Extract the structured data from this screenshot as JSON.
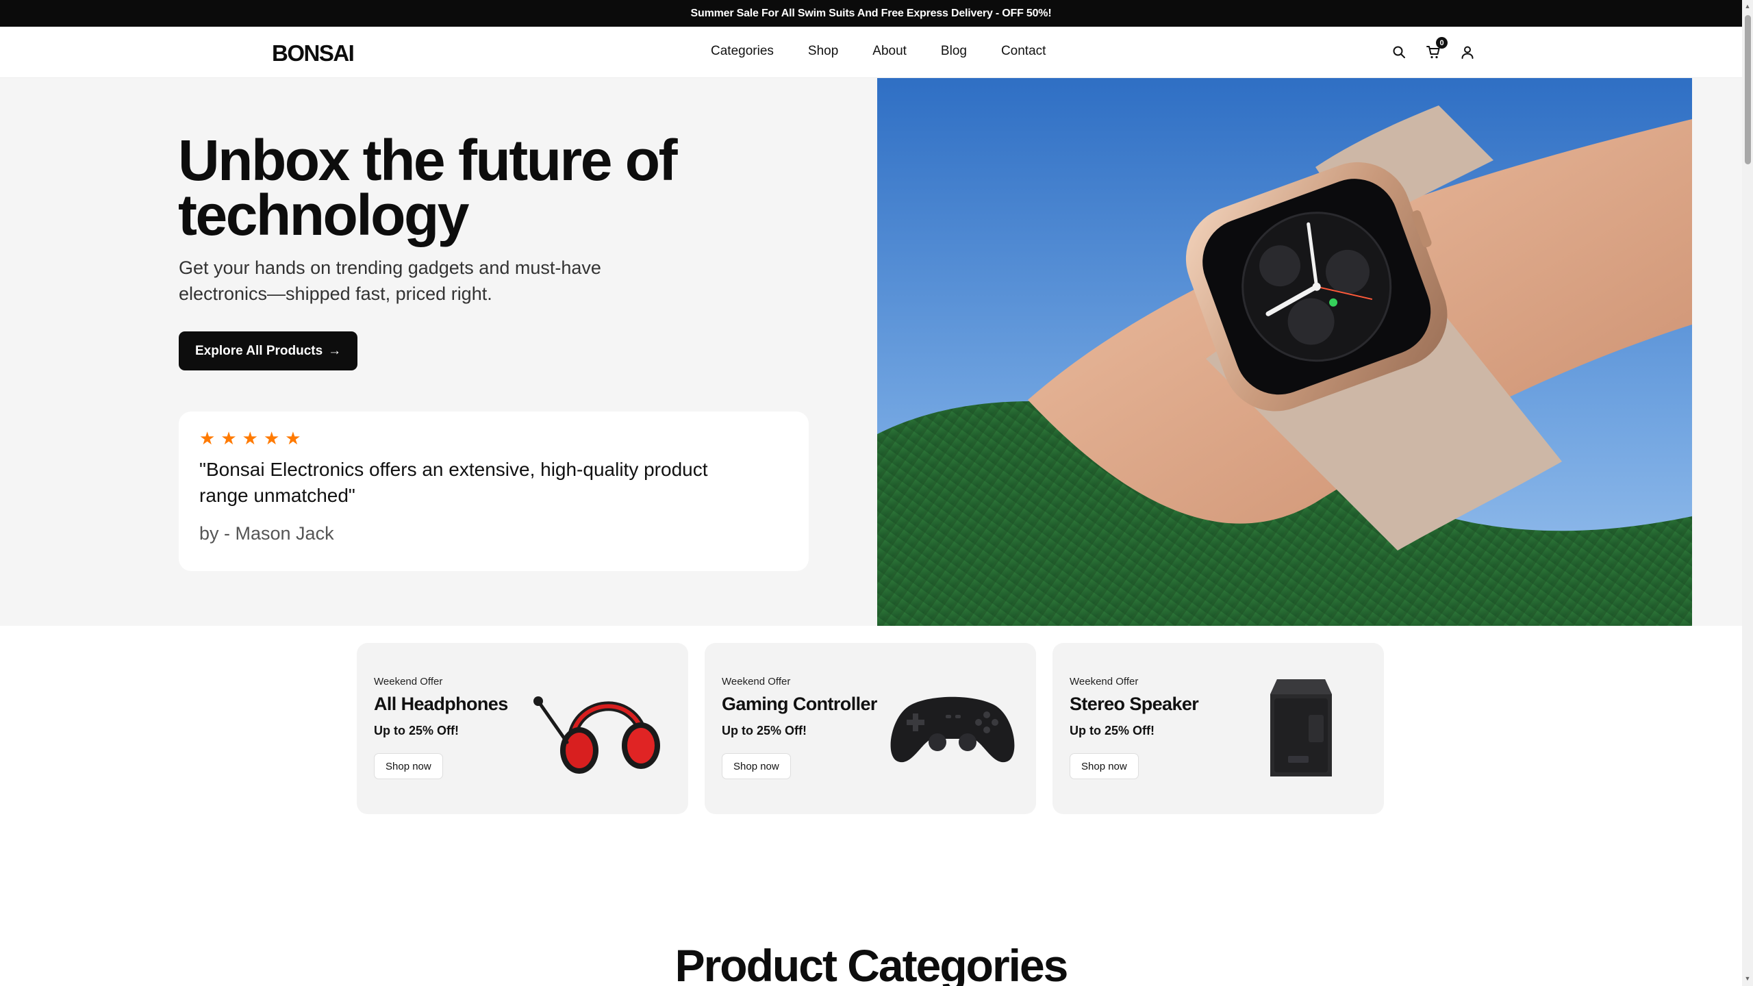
{
  "announcement": "Summer Sale For All Swim Suits And Free Express Delivery - OFF 50%!",
  "header": {
    "logo": "BONSAI",
    "nav": [
      "Categories",
      "Shop",
      "About",
      "Blog",
      "Contact"
    ],
    "cart_count": "0",
    "icons": [
      "search-icon",
      "cart-icon",
      "user-icon"
    ]
  },
  "hero": {
    "title": "Unbox the future of technology",
    "subtitle": "Get your hands on trending gadgets and must-have electronics—shipped fast, priced right.",
    "cta_label": "Explore All Products",
    "cta_arrow": "→",
    "review": {
      "rating": 5,
      "text": "\"Bonsai Electronics offers an extensive, high-quality product range unmatched\"",
      "author": "by - Mason Jack"
    }
  },
  "offers": [
    {
      "kicker": "Weekend Offer",
      "title": "All Headphones",
      "discount": "Up to 25% Off!",
      "button": "Shop now"
    },
    {
      "kicker": "Weekend Offer",
      "title": "Gaming Controller",
      "discount": "Up to 25% Off!",
      "button": "Shop now"
    },
    {
      "kicker": "Weekend Offer",
      "title": "Stereo Speaker",
      "discount": "Up to 25% Off!",
      "button": "Shop now"
    }
  ],
  "sections": {
    "categories_title": "Product Categories"
  },
  "colors": {
    "accent_star": "#ff7a00",
    "dark": "#0d0d0d",
    "hero_bg": "#f5f5f5"
  }
}
